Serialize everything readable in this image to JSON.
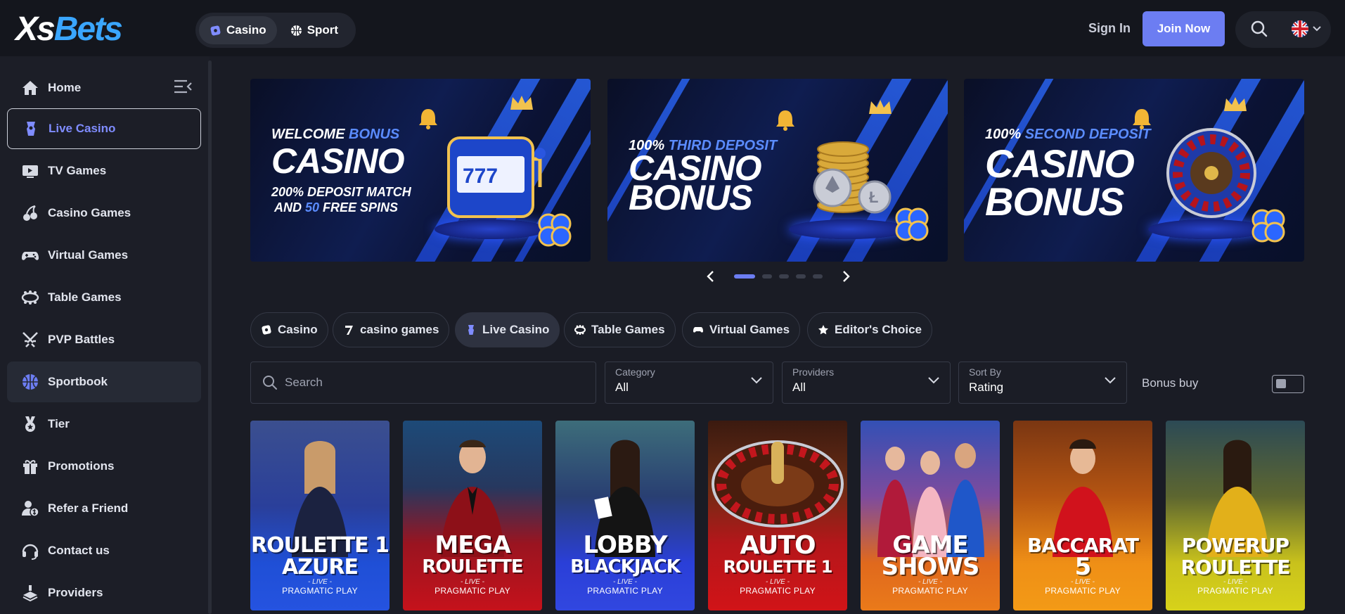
{
  "brand": {
    "logo_xs": "Xs",
    "logo_bets": "Bets"
  },
  "header": {
    "modes": [
      {
        "label": "Casino",
        "icon": "casino-chip-icon",
        "active": true
      },
      {
        "label": "Sport",
        "icon": "basketball-icon",
        "active": false
      }
    ],
    "sign_in": "Sign In",
    "join_now": "Join Now"
  },
  "sidebar": {
    "items": [
      {
        "label": "Home",
        "icon": "home-icon"
      },
      {
        "label": "Live Casino",
        "icon": "live-casino-icon",
        "active": true
      },
      {
        "label": "TV Games",
        "icon": "tv-icon"
      },
      {
        "label": "Casino Games",
        "icon": "cherries-icon"
      },
      {
        "label": "Virtual Games",
        "icon": "gamepad-icon"
      },
      {
        "label": "Table Games",
        "icon": "table-icon"
      },
      {
        "label": "PVP Battles",
        "icon": "crossed-swords-icon"
      },
      {
        "label": "Sportbook",
        "icon": "basketball-icon"
      },
      {
        "label": "Tier",
        "icon": "medal-icon"
      },
      {
        "label": "Promotions",
        "icon": "gift-icon"
      },
      {
        "label": "Refer a Friend",
        "icon": "refer-icon"
      },
      {
        "label": "Contact us",
        "icon": "headset-icon"
      },
      {
        "label": "Providers",
        "icon": "providers-icon"
      }
    ]
  },
  "banners": [
    {
      "top_a": "WELCOME ",
      "top_b": "BONUS",
      "big1": "CASINO",
      "big2": "",
      "sub1": "200% DEPOSIT MATCH",
      "sub2_a": "AND ",
      "sub2_b": "50",
      "sub2_c": " FREE SPINS"
    },
    {
      "top_a": "100% ",
      "top_b": "THIRD DEPOSIT",
      "big1": "CASINO",
      "big2": "BONUS"
    },
    {
      "top_a": "100% ",
      "top_b": "SECOND DEPOSIT",
      "big1": "CASINO",
      "big2": "BONUS"
    }
  ],
  "carousel": {
    "total": 5,
    "active": 1
  },
  "tabs": [
    {
      "label": "Casino",
      "icon": "casino-chip-icon"
    },
    {
      "label": "casino games",
      "icon": "seven-icon"
    },
    {
      "label": "Live Casino",
      "icon": "live-casino-icon",
      "active": true
    },
    {
      "label": "Table Games",
      "icon": "table-icon"
    },
    {
      "label": "Virtual Games",
      "icon": "gamepad-icon"
    },
    {
      "label": "Editor's Choice",
      "icon": "star-icon"
    }
  ],
  "filters": {
    "search_placeholder": "Search",
    "category": {
      "label": "Category",
      "value": "All"
    },
    "providers": {
      "label": "Providers",
      "value": "All"
    },
    "sort": {
      "label": "Sort By",
      "value": "Rating"
    },
    "bonus_buy": "Bonus buy"
  },
  "games": [
    {
      "line1": "ROULETTE 1",
      "line2": "AZURE",
      "live": "LIVE",
      "provider": "PRAGMATIC PLAY",
      "color": "#1f4fd6"
    },
    {
      "line1": "MEGA",
      "line2": "ROULETTE",
      "live": "LIVE",
      "provider": "PRAGMATIC PLAY",
      "color": "#c5121b"
    },
    {
      "line1": "LOBBY",
      "line2": "BLACKJACK",
      "live": "LIVE",
      "provider": "PRAGMATIC PLAY",
      "color": "#2a3fd8"
    },
    {
      "line1": "AUTO",
      "line2": "ROULETTE 1",
      "live": "LIVE",
      "provider": "PRAGMATIC PLAY",
      "color": "#d11418"
    },
    {
      "line1": "GAME",
      "line2": "SHOWS",
      "live": "LIVE",
      "provider": "PRAGMATIC PLAY",
      "color": "#ea7a1a"
    },
    {
      "line1": "BACCARAT",
      "line2": "5",
      "live": "LIVE",
      "provider": "PRAGMATIC PLAY",
      "color": "#ef8f16"
    },
    {
      "line1": "POWERUP",
      "line2": "ROULETTE",
      "live": "LIVE",
      "provider": "PRAGMATIC PLAY",
      "color": "#c9c21c"
    }
  ]
}
